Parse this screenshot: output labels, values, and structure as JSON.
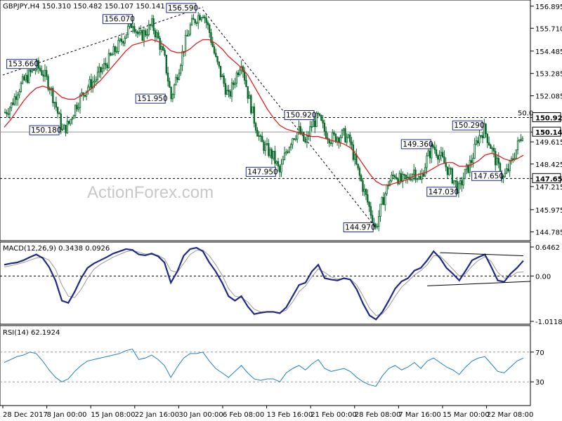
{
  "chart_data": [
    {
      "type": "line",
      "subtype": "candlestick",
      "title": "GBPJPY,H4  150.310 150.482 150.107 150.141",
      "ylim": [
        144.5,
        157.0
      ],
      "y_ticks": [
        "156.895",
        "155.710",
        "154.485",
        "153.285",
        "152.085",
        "150.920",
        "150.141",
        "149.615",
        "148.425",
        "147.650",
        "147.215",
        "145.975",
        "144.785"
      ],
      "x_labels": [
        "28 Dec 2017",
        "8 Jan 00:00",
        "15 Jan 08:00",
        "22 Jan 16:00",
        "30 Jan 00:00",
        "6 Feb 08:00",
        "13 Feb 16:00",
        "21 Feb 00:00",
        "28 Feb 08:00",
        "7 Mar 16:00",
        "15 Mar 00:00",
        "22 Mar 08:00"
      ],
      "price_close": [
        151.2,
        151.6,
        152.4,
        152.9,
        153.3,
        153.66,
        153.3,
        152.6,
        151.5,
        150.18,
        150.6,
        151.5,
        152.1,
        152.6,
        152.9,
        153.4,
        153.9,
        154.4,
        154.9,
        155.5,
        156.07,
        155.2,
        155.5,
        155.9,
        155.1,
        154.0,
        151.95,
        153.3,
        154.7,
        155.8,
        156.3,
        156.59,
        155.5,
        154.0,
        153.0,
        152.0,
        153.0,
        154.0,
        152.2,
        150.8,
        149.6,
        149.2,
        148.8,
        147.95,
        149.1,
        149.9,
        150.2,
        149.5,
        150.5,
        150.92,
        150.2,
        149.8,
        149.9,
        150.0,
        149.6,
        148.3,
        147.2,
        146.1,
        144.97,
        146.3,
        147.4,
        147.9,
        147.5,
        147.6,
        148.1,
        147.5,
        148.7,
        149.36,
        148.9,
        148.3,
        147.7,
        147.03,
        147.9,
        148.6,
        149.8,
        150.29,
        149.4,
        148.4,
        147.65,
        148.3,
        149.2,
        150.141
      ],
      "ma_values": [
        150.4,
        150.8,
        151.3,
        151.8,
        152.2,
        152.5,
        152.6,
        152.5,
        152.3,
        152.0,
        151.9,
        151.9,
        152.1,
        152.3,
        152.6,
        152.9,
        153.3,
        153.7,
        154.1,
        154.5,
        154.8,
        154.9,
        155.0,
        155.1,
        155.0,
        154.8,
        154.5,
        154.4,
        154.4,
        154.6,
        154.9,
        155.1,
        155.1,
        154.9,
        154.6,
        154.2,
        153.9,
        153.6,
        153.2,
        152.6,
        152.0,
        151.4,
        150.9,
        150.5,
        150.3,
        150.2,
        150.1,
        150.0,
        149.9,
        149.9,
        149.8,
        149.7,
        149.6,
        149.5,
        149.3,
        148.9,
        148.4,
        147.9,
        147.5,
        147.3,
        147.3,
        147.4,
        147.5,
        147.6,
        147.8,
        147.9,
        148.0,
        148.2,
        148.4,
        148.5,
        148.5,
        148.3,
        148.3,
        148.4,
        148.6,
        148.9,
        149.0,
        148.9,
        148.7,
        148.6,
        148.7,
        148.9
      ],
      "price_labels": [
        "156.590",
        "156.070",
        "153.660",
        "151.950",
        "150.180",
        "150.920",
        "147.950",
        "144.970",
        "149.360",
        "147.030",
        "147.650",
        "150.290"
      ],
      "levels": [
        {
          "value": 150.92,
          "label": "150.920",
          "note": "50.0"
        },
        {
          "value": 150.141,
          "label": "150.141"
        },
        {
          "value": 147.65,
          "label": "147.650"
        }
      ],
      "watermark": "ActionForex.com"
    },
    {
      "type": "line",
      "title": "MACD(12,26,9) 0.3438 0.0926",
      "ylim": [
        -1.0118,
        0.6462
      ],
      "y_ticks": [
        "0.6462",
        "0.00",
        "-1.0118"
      ],
      "macd": [
        0.25,
        0.28,
        0.3,
        0.35,
        0.42,
        0.48,
        0.4,
        0.2,
        -0.1,
        -0.55,
        -0.6,
        -0.35,
        -0.05,
        0.18,
        0.28,
        0.35,
        0.42,
        0.5,
        0.55,
        0.6,
        0.58,
        0.48,
        0.46,
        0.5,
        0.44,
        0.3,
        -0.15,
        0.1,
        0.45,
        0.6,
        0.63,
        0.55,
        0.3,
        0.1,
        -0.15,
        -0.45,
        -0.55,
        -0.45,
        -0.68,
        -0.85,
        -0.82,
        -0.8,
        -0.8,
        -0.83,
        -0.7,
        -0.45,
        -0.2,
        -0.15,
        0.1,
        0.25,
        -0.05,
        -0.08,
        -0.1,
        -0.05,
        -0.08,
        -0.3,
        -0.62,
        -0.88,
        -0.97,
        -0.8,
        -0.55,
        -0.28,
        -0.12,
        -0.05,
        0.12,
        0.18,
        0.35,
        0.55,
        0.4,
        0.18,
        0.05,
        -0.1,
        0.12,
        0.35,
        0.42,
        0.48,
        0.2,
        -0.1,
        -0.13,
        0.05,
        0.18,
        0.34
      ],
      "signal": [
        0.2,
        0.23,
        0.26,
        0.3,
        0.35,
        0.4,
        0.42,
        0.35,
        0.15,
        -0.2,
        -0.45,
        -0.48,
        -0.3,
        -0.05,
        0.15,
        0.26,
        0.34,
        0.42,
        0.48,
        0.54,
        0.57,
        0.53,
        0.49,
        0.48,
        0.46,
        0.38,
        0.12,
        0.08,
        0.28,
        0.48,
        0.57,
        0.58,
        0.45,
        0.25,
        0.02,
        -0.28,
        -0.45,
        -0.48,
        -0.58,
        -0.74,
        -0.8,
        -0.81,
        -0.81,
        -0.82,
        -0.76,
        -0.58,
        -0.35,
        -0.22,
        -0.02,
        0.16,
        0.08,
        -0.02,
        -0.07,
        -0.06,
        -0.07,
        -0.2,
        -0.45,
        -0.72,
        -0.88,
        -0.85,
        -0.68,
        -0.45,
        -0.25,
        -0.12,
        0.02,
        0.12,
        0.25,
        0.45,
        0.45,
        0.3,
        0.15,
        0.0,
        0.05,
        0.22,
        0.35,
        0.43,
        0.32,
        0.08,
        -0.05,
        -0.02,
        0.08,
        0.09
      ],
      "trendlines": "converging triangle"
    },
    {
      "type": "line",
      "title": "RSI(14) 62.1924",
      "ylim": [
        0,
        100
      ],
      "y_ticks": [
        "70",
        "30"
      ],
      "rsi": [
        56,
        60,
        64,
        66,
        70,
        68,
        58,
        46,
        36,
        30,
        34,
        44,
        52,
        58,
        60,
        62,
        64,
        66,
        68,
        72,
        74,
        60,
        62,
        66,
        60,
        52,
        36,
        50,
        62,
        68,
        68,
        70,
        58,
        48,
        42,
        36,
        44,
        52,
        42,
        34,
        32,
        34,
        34,
        30,
        42,
        48,
        52,
        46,
        54,
        60,
        48,
        44,
        46,
        48,
        44,
        36,
        30,
        26,
        24,
        38,
        48,
        52,
        46,
        50,
        56,
        48,
        58,
        62,
        56,
        50,
        46,
        40,
        50,
        58,
        62,
        64,
        54,
        44,
        42,
        50,
        58,
        62
      ]
    }
  ]
}
